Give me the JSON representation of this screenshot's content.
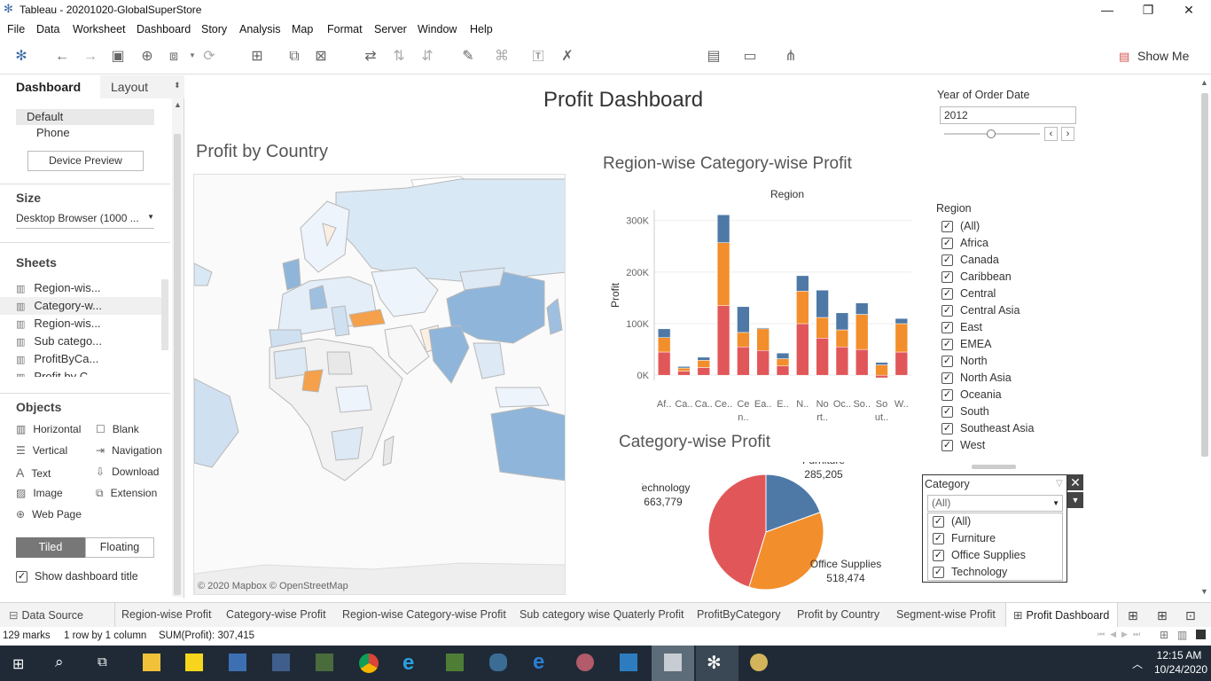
{
  "window": {
    "title": "Tableau - 20201020-GlobalSuperStore",
    "minimize": "—",
    "restore": "❐",
    "close": "✕"
  },
  "menu": [
    "File",
    "Data",
    "Worksheet",
    "Dashboard",
    "Story",
    "Analysis",
    "Map",
    "Format",
    "Server",
    "Window",
    "Help"
  ],
  "toolbar": {
    "show_me": "Show Me"
  },
  "left_pane": {
    "tabs": {
      "dashboard": "Dashboard",
      "layout": "Layout"
    },
    "device": {
      "default": "Default",
      "phone": "Phone",
      "preview_button": "Device Preview"
    },
    "size": {
      "label": "Size",
      "value": "Desktop Browser (1000 ..."
    },
    "sheets_label": "Sheets",
    "sheets": [
      "Region-wis...",
      "Category-w...",
      "Region-wis...",
      "Sub catego...",
      "ProfitByCa...",
      "Profit by C..."
    ],
    "objects_label": "Objects",
    "objects": [
      [
        "Horizontal",
        "Blank"
      ],
      [
        "Vertical",
        "Navigation"
      ],
      [
        "Text",
        "Download"
      ],
      [
        "Image",
        "Extension"
      ],
      [
        "Web Page",
        ""
      ]
    ],
    "tiled": "Tiled",
    "floating": "Floating",
    "show_title": "Show dashboard title"
  },
  "dashboard": {
    "title": "Profit Dashboard",
    "map_title": "Profit by Country",
    "map_credit": "© 2020 Mapbox © OpenStreetMap",
    "bar_title": "Region-wise Category-wise Profit",
    "pie_title": "Category-wise Profit",
    "year_filter": {
      "label": "Year of Order Date",
      "value": "2012"
    },
    "region_filter": {
      "label": "Region",
      "items": [
        "(All)",
        "Africa",
        "Canada",
        "Caribbean",
        "Central",
        "Central Asia",
        "East",
        "EMEA",
        "North",
        "North Asia",
        "Oceania",
        "South",
        "Southeast Asia",
        "West"
      ]
    },
    "category_filter": {
      "label": "Category",
      "value": "(All)",
      "items": [
        "(All)",
        "Furniture",
        "Office Supplies",
        "Technology"
      ]
    }
  },
  "chart_data": [
    {
      "type": "bar",
      "title": "Region-wise Category-wise Profit",
      "xlabel": "Region",
      "ylabel": "Profit",
      "categories": [
        "Af..",
        "Ca..",
        "Ca..",
        "Ce..",
        "Ce n..",
        "Ea..",
        "E..",
        "N..",
        "No rt..",
        "Oc..",
        "So..",
        "So ut..",
        "W.."
      ],
      "tick_labels": [
        "Af..",
        "Ca..",
        "Ca..",
        "Ce..",
        "Ce",
        "Ea..",
        "E..",
        "N..",
        "No",
        "Oc..",
        "So..",
        "So",
        "W.."
      ],
      "tick_labels_2": [
        "",
        "",
        "",
        "",
        "n..",
        "",
        "",
        "",
        "rt..",
        "",
        "",
        "ut..",
        ""
      ],
      "ylim": [
        -10000,
        320000
      ],
      "yticks": [
        "0K",
        "100K",
        "200K",
        "300K"
      ],
      "series": [
        {
          "name": "Technology",
          "color": "#e15759",
          "values": [
            45000,
            8000,
            15000,
            135000,
            55000,
            48000,
            18000,
            100000,
            72000,
            55000,
            50000,
            -5000,
            45000
          ]
        },
        {
          "name": "Office Supplies",
          "color": "#f28e2b",
          "values": [
            28000,
            6000,
            14000,
            122000,
            28000,
            42000,
            14000,
            63000,
            40000,
            33000,
            68000,
            20000,
            55000
          ]
        },
        {
          "name": "Furniture",
          "color": "#4e79a7",
          "values": [
            17000,
            3000,
            6000,
            54000,
            50000,
            2000,
            11000,
            30000,
            53000,
            33000,
            22000,
            5000,
            10000
          ]
        }
      ]
    },
    {
      "type": "pie",
      "title": "Category-wise Profit",
      "labels": [
        "Furniture",
        "Office Supplies",
        "Technology"
      ],
      "label_values": [
        "285,205",
        "518,474",
        "663,779"
      ],
      "values": [
        285205,
        518474,
        663779
      ],
      "colors": [
        "#4e79a7",
        "#f28e2b",
        "#e15759"
      ]
    }
  ],
  "tabs": {
    "data_source": "Data Source",
    "sheets": [
      "Region-wise Profit",
      "Category-wise Profit",
      "Region-wise Category-wise Profit",
      "Sub category wise Quaterly Profit",
      "ProfitByCategory",
      "Profit by Country",
      "Segment-wise Profit",
      "Profit Dashboard"
    ]
  },
  "status": {
    "marks": "129 marks",
    "rows": "1 row by 1 column",
    "sum": "SUM(Profit): 307,415"
  },
  "taskbar": {
    "time": "12:15 AM",
    "date": "10/24/2020"
  }
}
